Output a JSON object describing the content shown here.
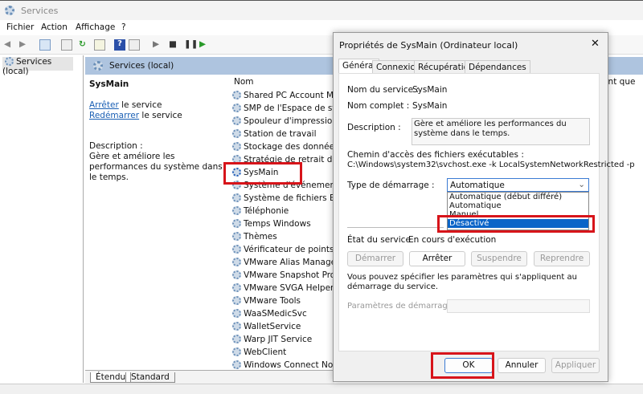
{
  "window": {
    "title": "Services"
  },
  "menu": [
    "Fichier",
    "Action",
    "Affichage",
    "?"
  ],
  "tree": {
    "root": "Services (local)"
  },
  "main": {
    "header": "Services (local)",
    "selected_service": "SysMain",
    "stop_link": "Arrêter",
    "stop_rest": " le service",
    "restart_link": "Redémarrer",
    "restart_rest": " le service",
    "description_label": "Description :",
    "description": "Gère et améliore les performances du système dans le temps.",
    "column_name": "Nom",
    "right_partial": "n tant que",
    "services": [
      "Shared PC Account Man",
      "SMP de l'Espace de stock",
      "Spouleur d'impression",
      "Station de travail",
      "Stockage des données ut",
      "Stratégie de retrait de la c",
      "SysMain",
      "Système d'événement C",
      "Système de fichiers EFS (",
      "Téléphonie",
      "Temps Windows",
      "Thèmes",
      "Vérificateur de points",
      "VMware Alias Manager a",
      "VMware Snapshot Provic",
      "VMware SVGA Helper Se",
      "VMware Tools",
      "WaaSMedicSvc",
      "WalletService",
      "Warp JIT Service",
      "WebClient",
      "Windows Connect Now"
    ],
    "bottom_tabs": [
      "Étendu",
      "Standard"
    ]
  },
  "dialog": {
    "title": "Propriétés de SysMain (Ordinateur local)",
    "close": "✕",
    "tabs": [
      "Général",
      "Connexion",
      "Récupération",
      "Dépendances"
    ],
    "service_name_label": "Nom du service :",
    "service_name": "SysMain",
    "display_name_label": "Nom complet :",
    "display_name": "SysMain",
    "description_label": "Description :",
    "description": "Gère et améliore les performances du système dans le temps.",
    "path_label": "Chemin d'accès des fichiers exécutables :",
    "path": "C:\\Windows\\system32\\svchost.exe -k LocalSystemNetworkRestricted -p",
    "startup_label": "Type de démarrage :",
    "startup_value": "Automatique",
    "startup_options": [
      "Automatique (début différé)",
      "Automatique",
      "Manuel",
      "Désactivé"
    ],
    "startup_highlighted": "Désactivé",
    "status_label": "État du service :",
    "status": "En cours d'exécution",
    "buttons": {
      "start": "Démarrer",
      "stop": "Arrêter",
      "pause": "Suspendre",
      "resume": "Reprendre"
    },
    "params_note": "Vous pouvez spécifier les paramètres qui s'appliquent au démarrage du service.",
    "params_label": "Paramètres de démarrage :",
    "params_value": "",
    "ok": "OK",
    "cancel": "Annuler",
    "apply": "Appliquer"
  },
  "colors": {
    "highlight": "#0a64c8",
    "annotation": "#d7141a",
    "header": "#aec4df"
  }
}
